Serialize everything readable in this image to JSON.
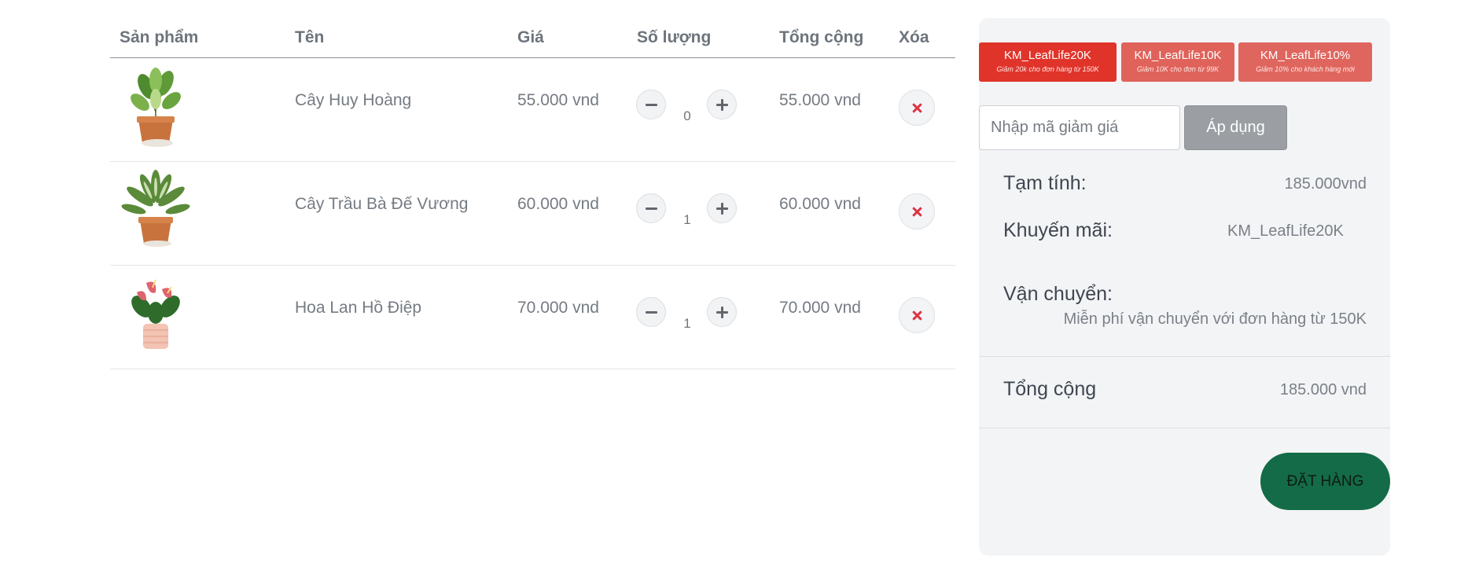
{
  "table": {
    "headers": {
      "product": "Sản phẩm",
      "name": "Tên",
      "price": "Giá",
      "quantity": "Số lượng",
      "total": "Tổng cộng",
      "remove": "Xóa"
    },
    "rows": [
      {
        "image": "potted-plant-dieffenbachia",
        "name": "Cây Huy Hoàng",
        "price": "55.000 vnd",
        "quantity": "0",
        "total": "55.000 vnd"
      },
      {
        "image": "potted-plant-aglaonema",
        "name": "Cây Trầu Bà Đế Vương",
        "price": "60.000 vnd",
        "quantity": "1",
        "total": "60.000 vnd"
      },
      {
        "image": "potted-plant-anthurium",
        "name": "Hoa Lan Hồ Điệp",
        "price": "70.000 vnd",
        "quantity": "1",
        "total": "70.000 vnd"
      }
    ]
  },
  "summary": {
    "coupons": [
      {
        "code": "KM_LeafLife20K",
        "desc": "Giảm 20k cho đơn hàng từ 150K",
        "color": "#e0342b"
      },
      {
        "code": "KM_LeafLife10K",
        "desc": "Giảm 10K cho đơn từ 99K",
        "color": "#df635b"
      },
      {
        "code": "KM_LeafLife10%",
        "desc": "Giảm 10% cho khách hàng mới",
        "color": "#df665e"
      }
    ],
    "code_placeholder": "Nhập mã giảm giá",
    "apply_label": "Áp dụng",
    "subtotal_label": "Tạm tính:",
    "subtotal_value": "185.000vnd",
    "promo_label": "Khuyến mãi:",
    "promo_value": "KM_LeafLife20K",
    "shipping_label": "Vận chuyển:",
    "shipping_note": "Miễn phí vận chuyển với đơn hàng từ 150K",
    "grand_total_label": "Tổng cộng",
    "grand_total_value": "185.000 vnd",
    "order_button": "ĐẶT HÀNG"
  },
  "colors": {
    "accent_green": "#136b47",
    "delete_red": "#dc3545",
    "panel_bg": "#f3f4f6"
  }
}
